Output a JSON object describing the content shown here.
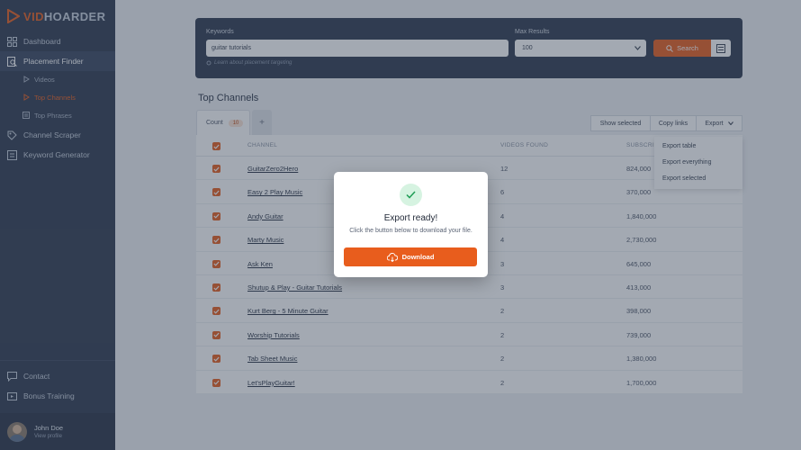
{
  "brand": {
    "logo_accent": "VID",
    "logo_rest": "HOARDER",
    "accent_color": "#e85d1d"
  },
  "sidebar": {
    "items": [
      {
        "label": "Dashboard",
        "icon": "dashboard-icon"
      },
      {
        "label": "Placement Finder",
        "icon": "placement-icon"
      },
      {
        "label": "Channel Scraper",
        "icon": "scraper-icon"
      },
      {
        "label": "Keyword Generator",
        "icon": "keyword-icon"
      }
    ],
    "subitems": [
      {
        "label": "Videos",
        "icon": "play-icon"
      },
      {
        "label": "Top Channels",
        "icon": "play-icon"
      },
      {
        "label": "Top Phrases",
        "icon": "list-icon"
      }
    ],
    "bottom_items": [
      {
        "label": "Contact",
        "icon": "chat-icon"
      },
      {
        "label": "Bonus Training",
        "icon": "training-icon"
      }
    ],
    "user": {
      "name": "John Doe",
      "sub": "View profile"
    }
  },
  "search": {
    "keywords_label": "Keywords",
    "keywords_value": "guitar tutorials",
    "hint": "Learn about placement targeting",
    "max_results_label": "Max Results",
    "max_results_value": "100",
    "search_label": "Search"
  },
  "section_title": "Top Channels",
  "tabs": {
    "count_label": "Count",
    "count_value": "10",
    "add_label": "+"
  },
  "actions": {
    "show_selected": "Show selected",
    "copy_links": "Copy links",
    "export": "Export"
  },
  "export_menu": [
    "Export table",
    "Export everything",
    "Export selected"
  ],
  "table": {
    "headers": {
      "channel": "CHANNEL",
      "videos": "VIDEOS FOUND",
      "subs": "SUBSCRIB"
    },
    "rows": [
      {
        "channel": "GuitarZero2Hero",
        "videos": "12",
        "subs": "824,000"
      },
      {
        "channel": "Easy 2 Play Music",
        "videos": "6",
        "subs": "370,000"
      },
      {
        "channel": "Andy Guitar",
        "videos": "4",
        "subs": "1,840,000"
      },
      {
        "channel": "Marty Music",
        "videos": "4",
        "subs": "2,730,000"
      },
      {
        "channel": "Ask Ken",
        "videos": "3",
        "subs": "645,000"
      },
      {
        "channel": "Shutup & Play - Guitar Tutorials",
        "videos": "3",
        "subs": "413,000"
      },
      {
        "channel": "Kurt Berg - 5 Minute Guitar",
        "videos": "2",
        "subs": "398,000"
      },
      {
        "channel": "Worship Tutorials",
        "videos": "2",
        "subs": "739,000"
      },
      {
        "channel": "Tab Sheet Music",
        "videos": "2",
        "subs": "1,380,000"
      },
      {
        "channel": "Let'sPlayGuitar!",
        "videos": "2",
        "subs": "1,700,000"
      }
    ]
  },
  "modal": {
    "title": "Export ready!",
    "text": "Click the button below to download your file.",
    "button": "Download"
  }
}
